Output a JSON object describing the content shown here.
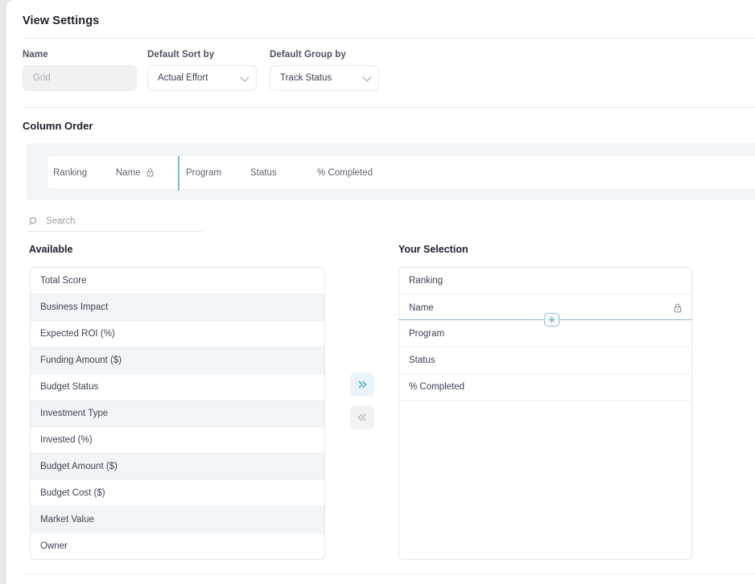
{
  "panel": {
    "title": "View Settings"
  },
  "form": {
    "name": {
      "label": "Name",
      "value": "",
      "placeholder": "Grid"
    },
    "sort_by": {
      "label": "Default Sort by",
      "value": "Actual Effort"
    },
    "group_by": {
      "label": "Default Group by",
      "value": "Track Status"
    }
  },
  "column_order": {
    "title": "Column Order",
    "columns": [
      {
        "label": "Ranking",
        "locked": false
      },
      {
        "label": "Name",
        "locked": true
      },
      {
        "label": "Program",
        "locked": false
      },
      {
        "label": "Status",
        "locked": false
      },
      {
        "label": "% Completed",
        "locked": false
      }
    ]
  },
  "search": {
    "placeholder": "Search",
    "value": ""
  },
  "available": {
    "label": "Available",
    "items": [
      "Total Score",
      "Business Impact",
      "Expected ROI (%)",
      "Funding Amount ($)",
      "Budget Status",
      "Investment Type",
      "Invested (%)",
      "Budget Amount ($)",
      "Budget Cost ($)",
      "Market Value",
      "Owner"
    ]
  },
  "selection": {
    "label": "Your Selection",
    "items": [
      {
        "label": "Ranking",
        "locked": false
      },
      {
        "label": "Name",
        "locked": true
      },
      {
        "label": "Program",
        "locked": false
      },
      {
        "label": "Status",
        "locked": false
      },
      {
        "label": "% Completed",
        "locked": false
      }
    ],
    "freeze_divider_after": "Name"
  },
  "transfer": {
    "move_right_title": "Move to selection",
    "move_left_title": "Remove from selection"
  },
  "colors": {
    "accent_blue": "#7fb8d4",
    "strip_bg": "#f1f5f8",
    "alt_row": "#f1f5f7",
    "text": "#3c4253"
  }
}
